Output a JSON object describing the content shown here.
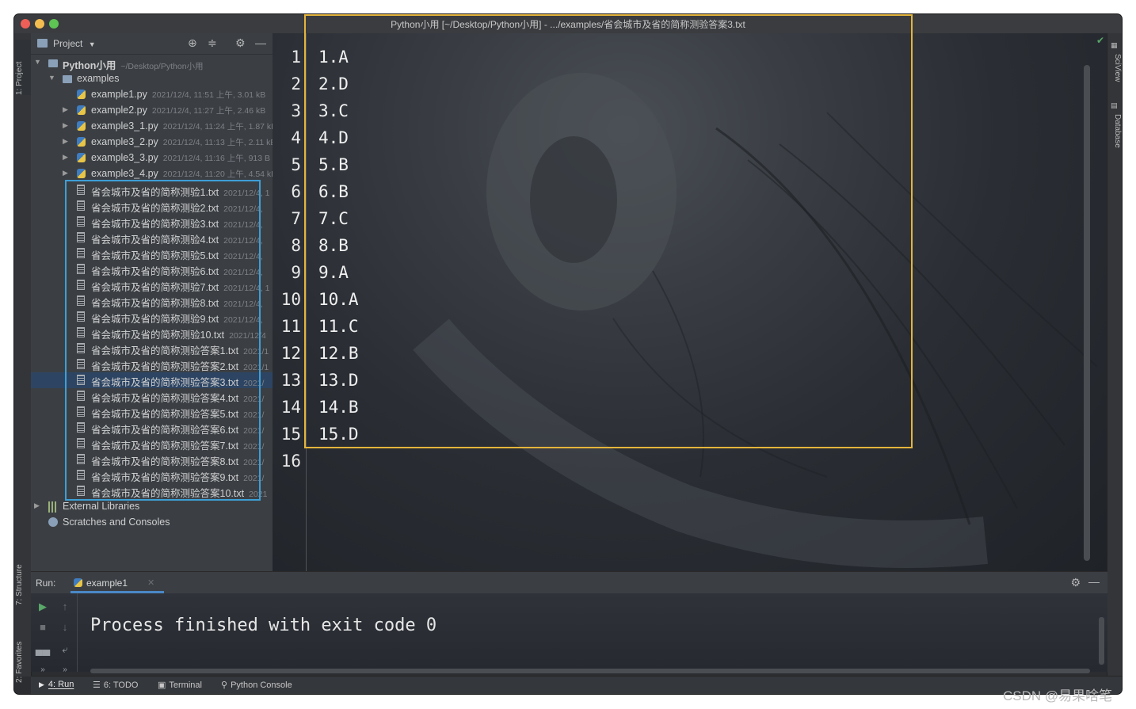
{
  "window": {
    "title": "Python小用 [~/Desktop/Python小用] - .../examples/省会城市及省的简称测验答案3.txt"
  },
  "left_stripe": {
    "project_tab": "1: Project",
    "structure_tab": "7: Structure",
    "favorites_tab": "2: Favorites"
  },
  "right_stripe": {
    "sciview_tab": "SciView",
    "database_tab": "Database"
  },
  "project_panel": {
    "header_label": "Project",
    "root": {
      "name": "Python小用",
      "path": "~/Desktop/Python小用"
    },
    "examples_folder": "examples",
    "py_files": [
      {
        "name": "example1.py",
        "meta": "2021/12/4, 11:51 上午, 3.01 kB"
      },
      {
        "name": "example2.py",
        "meta": "2021/12/4, 11:27 上午, 2.46 kB"
      },
      {
        "name": "example3_1.py",
        "meta": "2021/12/4, 11:24 上午, 1.87 kB"
      },
      {
        "name": "example3_2.py",
        "meta": "2021/12/4, 11:13 上午, 2.11 kB"
      },
      {
        "name": "example3_3.py",
        "meta": "2021/12/4, 11:16 上午, 913 B"
      },
      {
        "name": "example3_4.py",
        "meta": "2021/12/4, 11:20 上午, 4.54 kB"
      }
    ],
    "txt_files": [
      {
        "name": "省会城市及省的简称测验1.txt",
        "meta": "2021/12/4, 1"
      },
      {
        "name": "省会城市及省的简称测验2.txt",
        "meta": "2021/12/4,"
      },
      {
        "name": "省会城市及省的简称测验3.txt",
        "meta": "2021/12/4,"
      },
      {
        "name": "省会城市及省的简称测验4.txt",
        "meta": "2021/12/4,"
      },
      {
        "name": "省会城市及省的简称测验5.txt",
        "meta": "2021/12/4,"
      },
      {
        "name": "省会城市及省的简称测验6.txt",
        "meta": "2021/12/4,"
      },
      {
        "name": "省会城市及省的简称测验7.txt",
        "meta": "2021/12/4, 1"
      },
      {
        "name": "省会城市及省的简称测验8.txt",
        "meta": "2021/12/4,"
      },
      {
        "name": "省会城市及省的简称测验9.txt",
        "meta": "2021/12/4,"
      },
      {
        "name": "省会城市及省的简称测验10.txt",
        "meta": "2021/12/4"
      },
      {
        "name": "省会城市及省的简称测验答案1.txt",
        "meta": "2021/1"
      },
      {
        "name": "省会城市及省的简称测验答案2.txt",
        "meta": "2021/1"
      },
      {
        "name": "省会城市及省的简称测验答案3.txt",
        "meta": "2021/"
      },
      {
        "name": "省会城市及省的简称测验答案4.txt",
        "meta": "2021/"
      },
      {
        "name": "省会城市及省的简称测验答案5.txt",
        "meta": "2021/"
      },
      {
        "name": "省会城市及省的简称测验答案6.txt",
        "meta": "2021/"
      },
      {
        "name": "省会城市及省的简称测验答案7.txt",
        "meta": "2021/"
      },
      {
        "name": "省会城市及省的简称测验答案8.txt",
        "meta": "2021/"
      },
      {
        "name": "省会城市及省的简称测验答案9.txt",
        "meta": "2021/"
      },
      {
        "name": "省会城市及省的简称测验答案10.txt",
        "meta": "2021"
      }
    ],
    "selected_file": "省会城市及省的简称测验答案3.txt",
    "external_libraries": "External Libraries",
    "scratches": "Scratches and Consoles"
  },
  "editor": {
    "line_numbers": [
      "1",
      "2",
      "3",
      "4",
      "5",
      "6",
      "7",
      "8",
      "9",
      "10",
      "11",
      "12",
      "13",
      "14",
      "15",
      "16"
    ],
    "lines": [
      "1.A",
      "2.D",
      "3.C",
      "4.D",
      "5.B",
      "6.B",
      "7.C",
      "8.B",
      "9.A",
      "10.A",
      "11.C",
      "12.B",
      "13.D",
      "14.B",
      "15.D",
      ""
    ]
  },
  "run_panel": {
    "label": "Run:",
    "tab": "example1",
    "output": "Process finished with exit code 0"
  },
  "status_bar": {
    "run_tab": "4: Run",
    "todo_tab": "6: TODO",
    "terminal_tab": "Terminal",
    "python_console_tab": "Python Console"
  },
  "watermark": "CSDN @易果啥笔",
  "colors": {
    "highlight_yellow": "#e4b43c",
    "highlight_blue": "#3d9fd6",
    "selection": "#2d4563",
    "tab_underline": "#4a88c7"
  }
}
